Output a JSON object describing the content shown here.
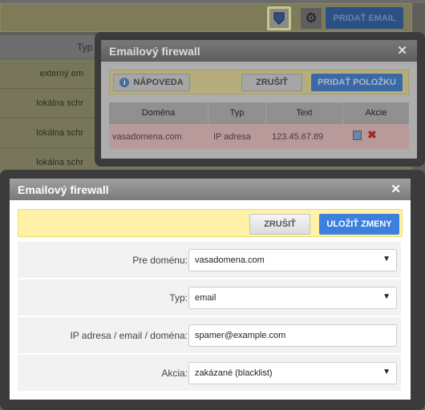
{
  "background": {
    "add_email_label": "PRIDAŤ EMAIL",
    "table_header_typ": "Typ",
    "rows": [
      "externý em",
      "lokálna schr",
      "lokálna schr",
      "lokálna schr"
    ]
  },
  "list_dialog": {
    "title": "Emailový firewall",
    "close": "✕",
    "help_label": "NÁPOVEDA",
    "cancel_label": "ZRUŠIŤ",
    "add_item_label": "PRIDAŤ POLOŽKU",
    "columns": [
      "Doména",
      "Typ",
      "Text",
      "Akcie"
    ],
    "rows": [
      {
        "domain": "vasadomena.com",
        "type": "IP adresa",
        "text": "123.45.67.89"
      }
    ]
  },
  "edit_dialog": {
    "title": "Emailový firewall",
    "close": "✕",
    "cancel_label": "ZRUŠIŤ",
    "save_label": "ULOŽIŤ ZMENY",
    "fields": [
      {
        "label": "Pre doménu:",
        "value": "vasadomena.com",
        "kind": "select"
      },
      {
        "label": "Typ:",
        "value": "email",
        "kind": "select"
      },
      {
        "label": "IP adresa / email / doména:",
        "value": "spamer@example.com",
        "kind": "input"
      },
      {
        "label": "Akcia:",
        "value": "zakázané (blacklist)",
        "kind": "select"
      }
    ]
  },
  "colors": {
    "primary": "#3d7fdc",
    "toolbar": "#fff1a8",
    "error_row": "#b89a9a"
  }
}
